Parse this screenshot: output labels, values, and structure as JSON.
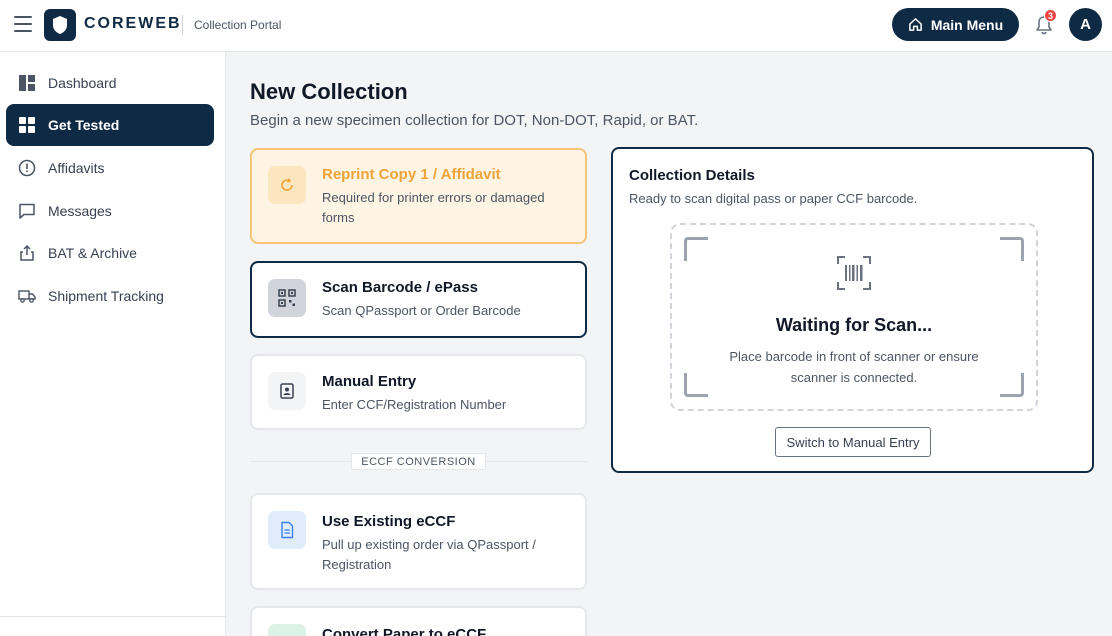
{
  "header": {
    "brand": "COREWEB",
    "portal": "Collection Portal",
    "main_menu_label": "Main Menu",
    "notification_count": "3",
    "avatar_initial": "A"
  },
  "sidebar": {
    "items": [
      {
        "label": "Dashboard",
        "icon": "dashboard-icon",
        "active": false
      },
      {
        "label": "Get Tested",
        "icon": "grid-icon",
        "active": true
      },
      {
        "label": "Affidavits",
        "icon": "alert-circle-icon",
        "active": false
      },
      {
        "label": "Messages",
        "icon": "message-icon",
        "active": false
      },
      {
        "label": "BAT & Archive",
        "icon": "share-icon",
        "active": false
      },
      {
        "label": "Shipment Tracking",
        "icon": "truck-icon",
        "active": false
      }
    ]
  },
  "main": {
    "title": "New Collection",
    "subtitle": "Begin a new specimen collection for DOT, Non-DOT, Rapid, or BAT.",
    "cards": {
      "reprint": {
        "title": "Reprint Copy 1 / Affidavit",
        "desc": "Required for printer errors or damaged forms"
      },
      "scan": {
        "title": "Scan Barcode / ePass",
        "desc": "Scan QPassport or Order Barcode"
      },
      "manual": {
        "title": "Manual Entry",
        "desc": "Enter CCF/Registration Number"
      },
      "existing": {
        "title": "Use Existing eCCF",
        "desc": "Pull up existing order via QPassport / Registration"
      },
      "convert": {
        "title": "Convert Paper to eCCF"
      }
    },
    "section_label": "ECCF CONVERSION"
  },
  "details": {
    "title": "Collection Details",
    "subtitle": "Ready to scan digital pass or paper CCF barcode.",
    "wait_title": "Waiting for Scan...",
    "wait_desc": "Place barcode in front of scanner or ensure scanner is connected.",
    "switch_label": "Switch to Manual Entry"
  },
  "colors": {
    "primary": "#0f2a44",
    "accent_orange": "#f0a43a",
    "badge_red": "#ef4444"
  }
}
